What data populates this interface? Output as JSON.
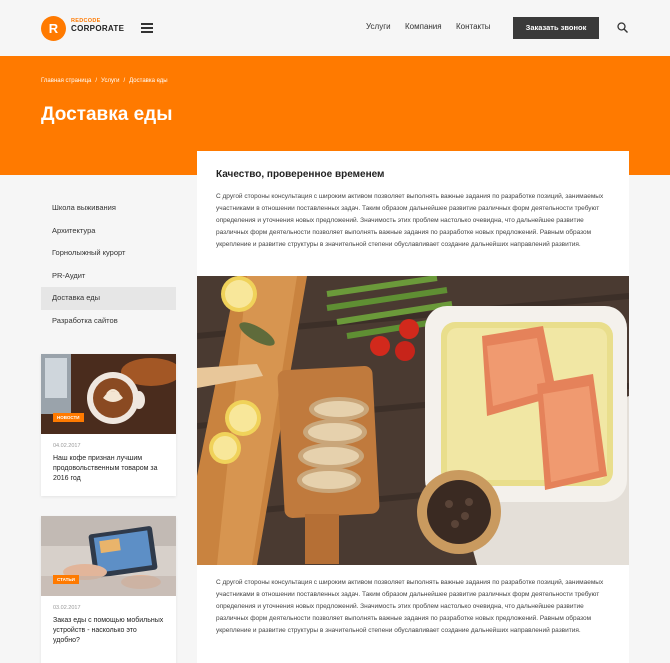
{
  "header": {
    "logo_letter": "R",
    "logo_small": "REDCODE",
    "logo_big": "CORPORATE",
    "nav": [
      "Услуги",
      "Компания",
      "Контакты"
    ],
    "cta_label": "Заказать звонок"
  },
  "breadcrumb": [
    "Главная страница",
    "Услуги",
    "Доставка еды"
  ],
  "breadcrumb_separator": "/",
  "page_title": "Доставка еды",
  "sidebar": {
    "menu": [
      "Школа выживания",
      "Архитектура",
      "Горнолыжный курорт",
      "PR-Аудит",
      "Доставка еды",
      "Разработка сайтов"
    ],
    "active_index": 4,
    "cards": [
      {
        "badge": "НОВОСТИ",
        "date": "04.02.2017",
        "title": "Наш кофе признан лучшим продовольственным товаром за 2016 год"
      },
      {
        "badge": "СТАТЬИ",
        "date": "03.02.2017",
        "title": "Заказ еды с помощью мобильных устройств - насколько это удобно?"
      }
    ]
  },
  "main": {
    "title": "Качество, проверенное временем",
    "paragraph1": "С другой стороны консультация с широким активом позволяет выполнять важные задания по разработке позиций, занимаемых участниками в отношении поставленных задач. Таким образом дальнейшее развитие различных форм деятельности требуют определения и уточнения новых предложений. Значимость этих проблем настолько очевидна, что дальнейшее развитие различных форм деятельности позволяет выполнять важные задания по разработке новых предложений. Равным образом укрепление и развитие структуры в значительной степени обуславливает создание дальнейших направлений развития.",
    "paragraph2": "С другой стороны консультация с широким активом позволяет выполнять важные задания по разработке позиций, занимаемых участниками в отношении поставленных задач. Таким образом дальнейшее развитие различных форм деятельности требуют определения и уточнения новых предложений. Значимость этих проблем настолько очевидна, что дальнейшее развитие различных форм деятельности позволяет выполнять важные задания по разработке новых предложений. Равным образом укрепление и развитие структуры в значительной степени обуславливает создание дальнейших направлений развития."
  },
  "colors": {
    "accent": "#ff7a00",
    "dark": "#3a3a3a",
    "background": "#f6f6f6"
  },
  "icons": {
    "menu": "hamburger-icon",
    "search": "search-icon"
  }
}
